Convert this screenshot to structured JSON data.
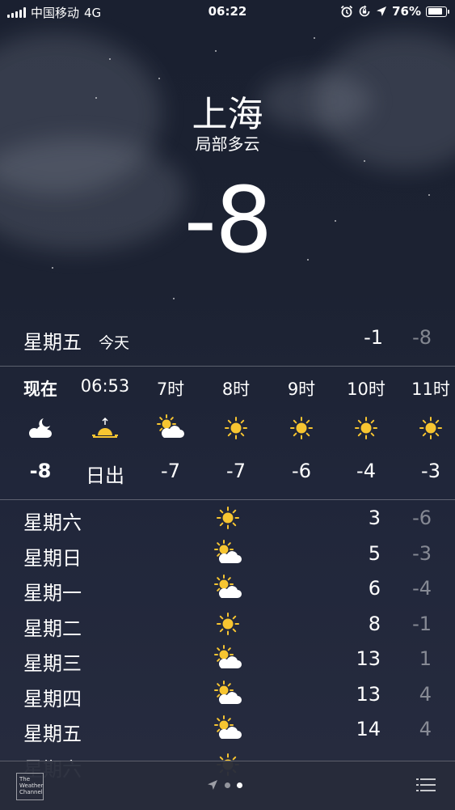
{
  "status_bar": {
    "carrier": "中国移动",
    "network": "4G",
    "time": "06:22",
    "battery": "76%",
    "battery_level": 0.76,
    "icons": [
      "signal-icon",
      "alarm-icon",
      "orientation-lock-icon",
      "location-icon",
      "battery-icon"
    ]
  },
  "location": {
    "city": "上海",
    "condition": "局部多云",
    "temperature": "-8"
  },
  "today": {
    "day": "星期五",
    "tag": "今天",
    "high": "-1",
    "low": "-8"
  },
  "hourly": [
    {
      "label": "现在",
      "icon": "moon-cloud-icon",
      "value": "-8",
      "bold": true
    },
    {
      "label": "06:53",
      "icon": "sunrise-icon",
      "value": "日出",
      "bold": false
    },
    {
      "label": "7时",
      "icon": "sun-cloud-icon",
      "value": "-7",
      "bold": false
    },
    {
      "label": "8时",
      "icon": "sun-icon",
      "value": "-7",
      "bold": false
    },
    {
      "label": "9时",
      "icon": "sun-icon",
      "value": "-6",
      "bold": false
    },
    {
      "label": "10时",
      "icon": "sun-icon",
      "value": "-4",
      "bold": false
    },
    {
      "label": "11时",
      "icon": "sun-icon",
      "value": "-3",
      "bold": false
    }
  ],
  "daily": [
    {
      "day": "星期六",
      "icon": "sun-icon",
      "high": "3",
      "low": "-6"
    },
    {
      "day": "星期日",
      "icon": "sun-cloud-icon",
      "high": "5",
      "low": "-3"
    },
    {
      "day": "星期一",
      "icon": "sun-cloud-icon",
      "high": "6",
      "low": "-4"
    },
    {
      "day": "星期二",
      "icon": "sun-icon",
      "high": "8",
      "low": "-1"
    },
    {
      "day": "星期三",
      "icon": "sun-cloud-icon",
      "high": "13",
      "low": "1"
    },
    {
      "day": "星期四",
      "icon": "sun-cloud-icon",
      "high": "13",
      "low": "4"
    },
    {
      "day": "星期五",
      "icon": "sun-cloud-icon",
      "high": "14",
      "low": "4"
    },
    {
      "day": "星期六",
      "icon": "sun-icon",
      "high": "",
      "low": ""
    }
  ],
  "bottom_bar": {
    "logo_text": [
      "The",
      "Weather",
      "Channel"
    ],
    "pages": [
      "location-arrow-icon",
      "dot",
      "dot-active"
    ],
    "list_icon": "list-icon"
  },
  "colors": {
    "sun": "#f7c531",
    "muted_text": "rgba(255,255,255,0.45)",
    "background": "#1c2232"
  }
}
